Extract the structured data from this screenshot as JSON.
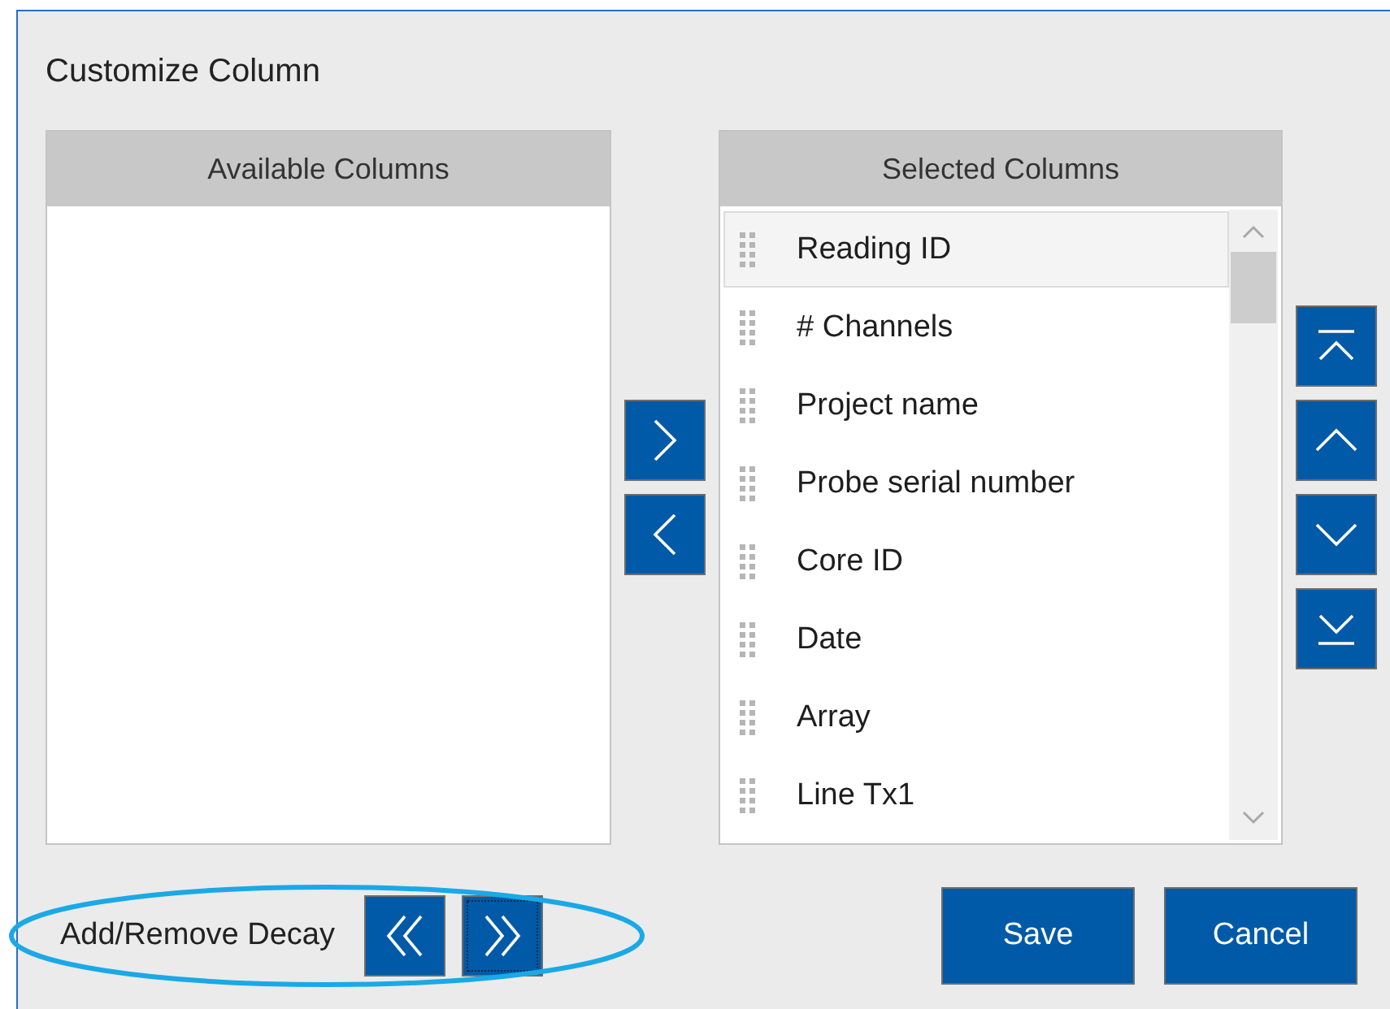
{
  "dialog": {
    "title": "Customize Column"
  },
  "available_columns": {
    "header": "Available Columns"
  },
  "selected_columns": {
    "header": "Selected Columns",
    "items": [
      {
        "label": "Reading ID",
        "selected": true
      },
      {
        "label": "# Channels",
        "selected": false
      },
      {
        "label": "Project name",
        "selected": false
      },
      {
        "label": "Probe serial number",
        "selected": false
      },
      {
        "label": "Core ID",
        "selected": false
      },
      {
        "label": "Date",
        "selected": false
      },
      {
        "label": "Array",
        "selected": false
      },
      {
        "label": "Line Tx1",
        "selected": false
      }
    ]
  },
  "decay": {
    "label": "Add/Remove Decay",
    "buttons": [
      {
        "kind": "remove",
        "focused": false
      },
      {
        "kind": "add",
        "focused": true
      }
    ]
  },
  "actions": [
    {
      "label": "Save"
    },
    {
      "label": "Cancel"
    }
  ],
  "highlight": {
    "kind": "ellipse"
  }
}
